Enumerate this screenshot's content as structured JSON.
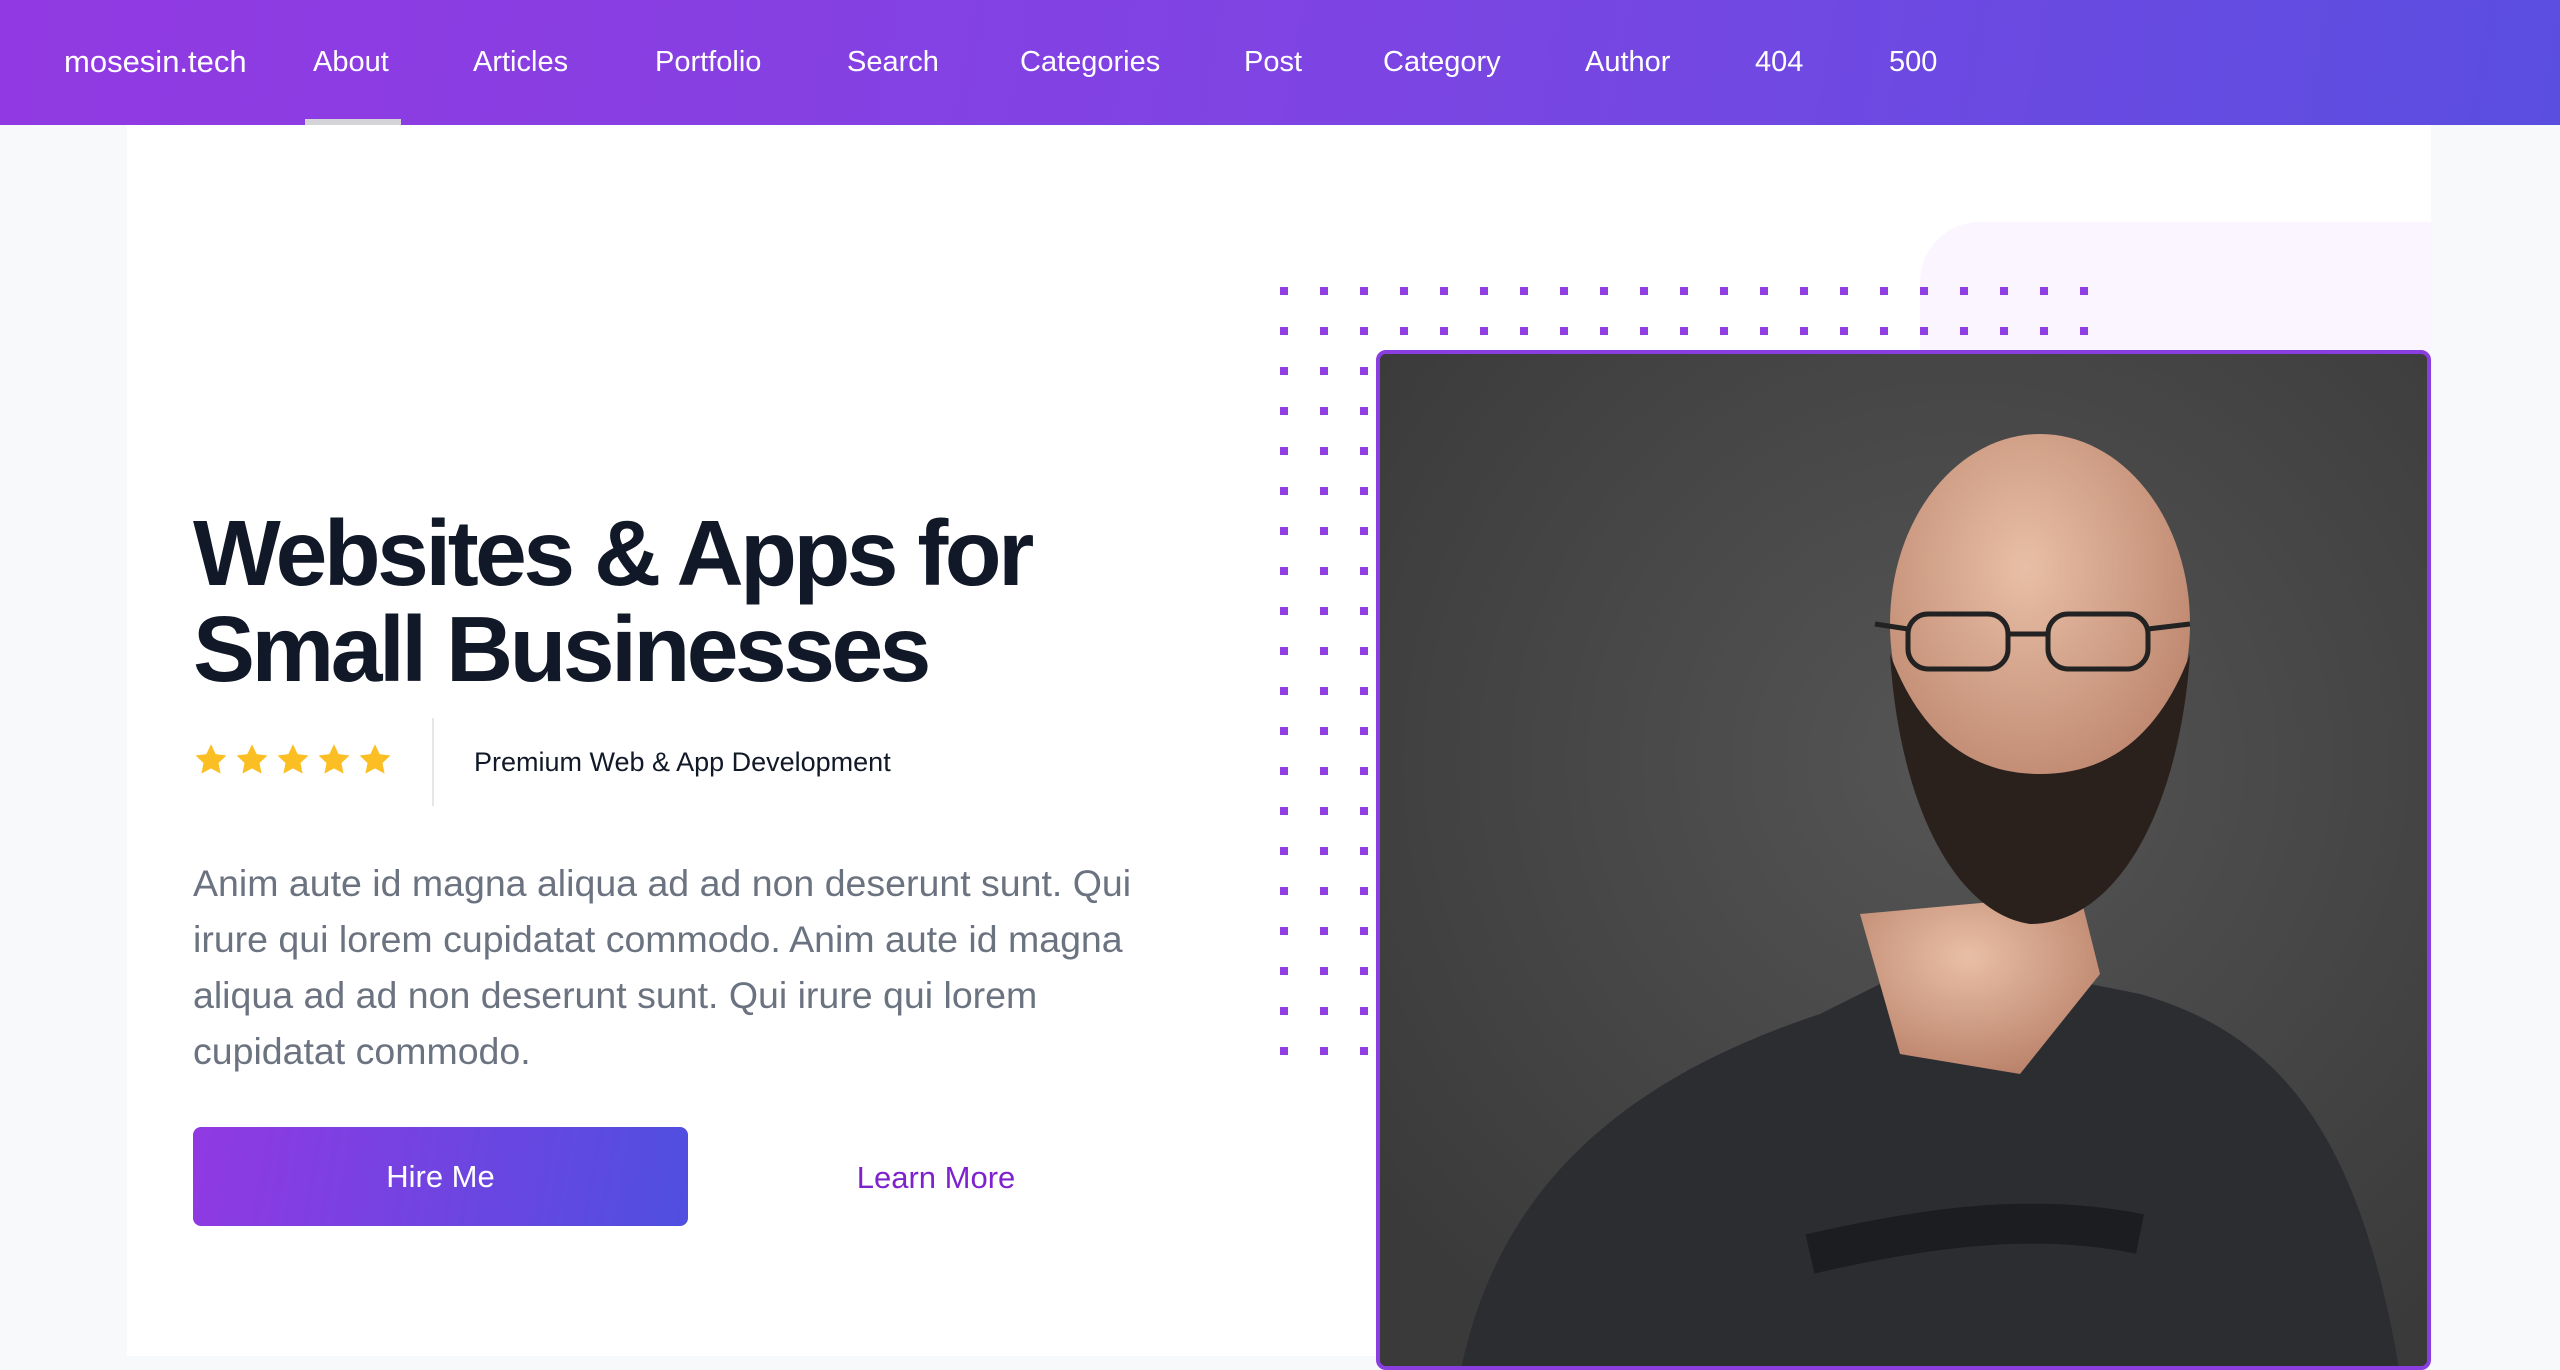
{
  "nav": {
    "logo": "mosesin.tech",
    "items": [
      {
        "label": "About",
        "active": true
      },
      {
        "label": "Articles"
      },
      {
        "label": "Portfolio"
      },
      {
        "label": "Search"
      },
      {
        "label": "Categories"
      },
      {
        "label": "Post"
      },
      {
        "label": "Category"
      },
      {
        "label": "Author"
      },
      {
        "label": "404"
      },
      {
        "label": "500"
      }
    ]
  },
  "hero": {
    "title_line1": "Websites & Apps for",
    "title_line2": "Small Businesses",
    "rating": 5,
    "rating_max": 5,
    "tagline": "Premium Web & App Development",
    "description": "Anim aute id magna aliqua ad ad non deserunt sunt. Qui irure qui lorem cupidatat commodo. Anim aute id magna aliqua ad ad non deserunt sunt. Qui irure qui lorem cupidatat commodo.",
    "primary_button": "Hire Me",
    "secondary_link": "Learn More"
  },
  "colors": {
    "accent": "#9333ea",
    "accent_end": "#4f46e5",
    "star": "#fbbf24",
    "heading": "#111827",
    "body": "#6b7280"
  }
}
